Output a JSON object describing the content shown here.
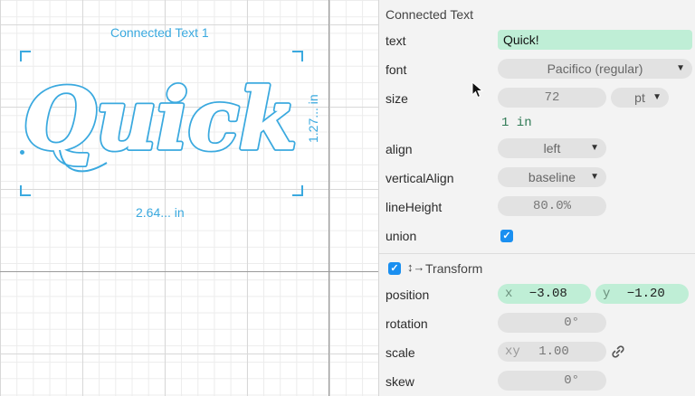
{
  "canvas": {
    "object_label": "Connected Text 1",
    "width_label": "2.64... in",
    "height_label": "1.27... in",
    "text_content": "Quick!",
    "accent_color": "#3aa9df"
  },
  "panel": {
    "title": "Connected Text",
    "text": {
      "label": "text",
      "value": "Quick!"
    },
    "font": {
      "label": "font",
      "value": "Pacifico (regular)"
    },
    "size": {
      "label": "size",
      "value": "72",
      "unit": "pt",
      "converted": "1 in"
    },
    "align": {
      "label": "align",
      "value": "left"
    },
    "verticalAlign": {
      "label": "verticalAlign",
      "value": "baseline"
    },
    "lineHeight": {
      "label": "lineHeight",
      "value": "80.0%"
    },
    "union": {
      "label": "union",
      "checked": true
    },
    "transform": {
      "header": "Transform",
      "enabled": true,
      "position": {
        "label": "position",
        "x_label": "x",
        "x": "−3.08",
        "y_label": "y",
        "y": "−1.20"
      },
      "rotation": {
        "label": "rotation",
        "value": "0°"
      },
      "scale": {
        "label": "scale",
        "prefix": "xy",
        "value": "1.00"
      },
      "skew": {
        "label": "skew",
        "value": "0°"
      }
    }
  },
  "icons": {
    "checkbox": "checkmark-icon",
    "transform": "move-arrows-icon",
    "link": "link-icon",
    "cursor": "mouse-pointer-icon"
  }
}
